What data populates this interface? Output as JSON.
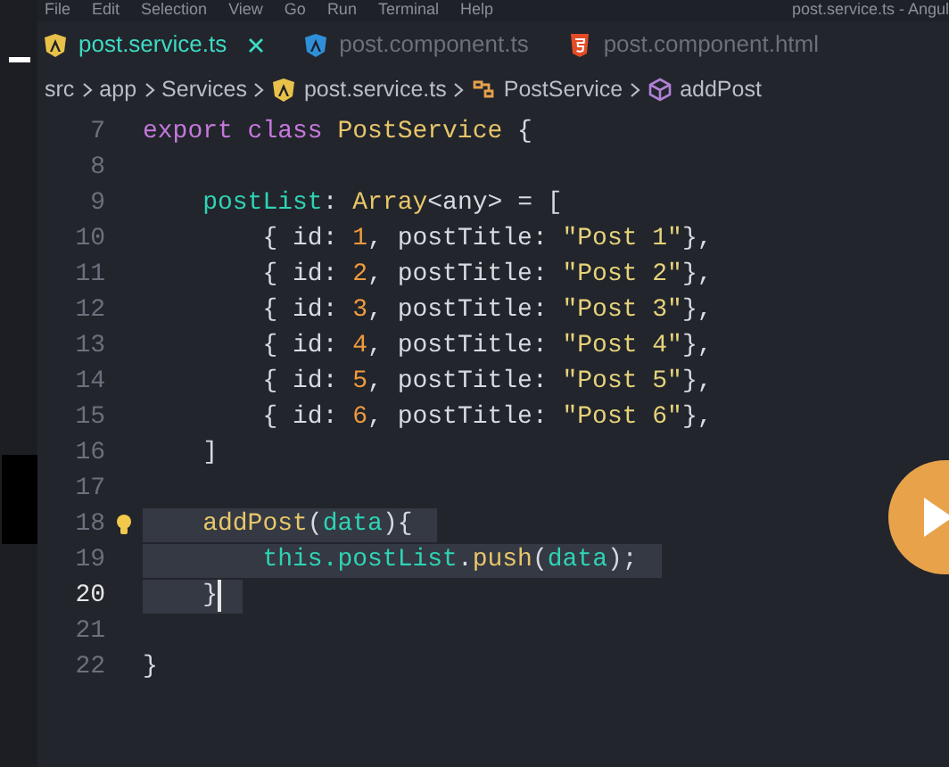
{
  "menu": [
    "File",
    "Edit",
    "Selection",
    "View",
    "Go",
    "Run",
    "Terminal",
    "Help"
  ],
  "window": {
    "title": "post.service.ts - Angul"
  },
  "tabs": [
    {
      "label": "post.service.ts",
      "kind": "angular",
      "selected": true
    },
    {
      "label": "post.component.ts",
      "kind": "angular",
      "selected": false
    },
    {
      "label": "post.component.html",
      "kind": "html",
      "selected": false
    }
  ],
  "breadcrumb": [
    {
      "label": "src",
      "kind": "folder"
    },
    {
      "label": "app",
      "kind": "folder"
    },
    {
      "label": "Services",
      "kind": "folder"
    },
    {
      "label": "post.service.ts",
      "kind": "angular"
    },
    {
      "label": "PostService",
      "kind": "class"
    },
    {
      "label": "addPost",
      "kind": "method"
    }
  ],
  "lines": [
    {
      "number": "7",
      "tokens": [
        {
          "kind": "keyword",
          "text": "export class "
        },
        {
          "kind": "type",
          "text": "PostService"
        },
        {
          "kind": "plain",
          "text": " {"
        }
      ]
    },
    {
      "number": "8"
    },
    {
      "number": "9",
      "tokens": [
        {
          "kind": "property",
          "text": "    postList"
        },
        {
          "kind": "plain",
          "text": ": "
        },
        {
          "kind": "type",
          "text": "Array"
        },
        {
          "kind": "plain",
          "text": "<any> = ["
        }
      ]
    },
    {
      "number": "10",
      "tokens": [
        {
          "kind": "plain",
          "text": "        { id: "
        },
        {
          "kind": "number",
          "text": "1"
        },
        {
          "kind": "plain",
          "text": ", postTitle: "
        },
        {
          "kind": "string",
          "text": "\"Post 1\""
        },
        {
          "kind": "plain",
          "text": "},"
        }
      ]
    },
    {
      "number": "11",
      "tokens": [
        {
          "kind": "plain",
          "text": "        { id: "
        },
        {
          "kind": "number",
          "text": "2"
        },
        {
          "kind": "plain",
          "text": ", postTitle: "
        },
        {
          "kind": "string",
          "text": "\"Post 2\""
        },
        {
          "kind": "plain",
          "text": "},"
        }
      ]
    },
    {
      "number": "12",
      "tokens": [
        {
          "kind": "plain",
          "text": "        { id: "
        },
        {
          "kind": "number",
          "text": "3"
        },
        {
          "kind": "plain",
          "text": ", postTitle: "
        },
        {
          "kind": "string",
          "text": "\"Post 3\""
        },
        {
          "kind": "plain",
          "text": "},"
        }
      ]
    },
    {
      "number": "13",
      "tokens": [
        {
          "kind": "plain",
          "text": "        { id: "
        },
        {
          "kind": "number",
          "text": "4"
        },
        {
          "kind": "plain",
          "text": ", postTitle: "
        },
        {
          "kind": "string",
          "text": "\"Post 4\""
        },
        {
          "kind": "plain",
          "text": "},"
        }
      ]
    },
    {
      "number": "14",
      "tokens": [
        {
          "kind": "plain",
          "text": "        { id: "
        },
        {
          "kind": "number",
          "text": "5"
        },
        {
          "kind": "plain",
          "text": ", postTitle: "
        },
        {
          "kind": "string",
          "text": "\"Post 5\""
        },
        {
          "kind": "plain",
          "text": "},"
        }
      ]
    },
    {
      "number": "15",
      "tokens": [
        {
          "kind": "plain",
          "text": "        { id: "
        },
        {
          "kind": "number",
          "text": "6"
        },
        {
          "kind": "plain",
          "text": ", postTitle: "
        },
        {
          "kind": "string",
          "text": "\"Post 6\""
        },
        {
          "kind": "plain",
          "text": "},"
        }
      ]
    },
    {
      "number": "16",
      "tokens": [
        {
          "kind": "plain",
          "text": "    ]"
        }
      ]
    },
    {
      "number": "17"
    },
    {
      "number": "18",
      "selected": true,
      "lightbulb": true,
      "tokens": [
        {
          "kind": "function",
          "text": "    addPost"
        },
        {
          "kind": "plain",
          "text": "("
        },
        {
          "kind": "property",
          "text": "data"
        },
        {
          "kind": "plain",
          "text": "){"
        }
      ]
    },
    {
      "number": "19",
      "selected": true,
      "tokens": [
        {
          "kind": "property",
          "text": "        this.postList"
        },
        {
          "kind": "plain",
          "text": "."
        },
        {
          "kind": "function",
          "text": "push"
        },
        {
          "kind": "plain",
          "text": "("
        },
        {
          "kind": "property",
          "text": "data"
        },
        {
          "kind": "plain",
          "text": ");"
        }
      ]
    },
    {
      "number": "20",
      "selected": true,
      "current": true,
      "tokens": [
        {
          "kind": "plain",
          "text": "    }"
        }
      ]
    },
    {
      "number": "21"
    },
    {
      "number": "22",
      "tokens": [
        {
          "kind": "plain",
          "text": "}"
        }
      ]
    }
  ]
}
